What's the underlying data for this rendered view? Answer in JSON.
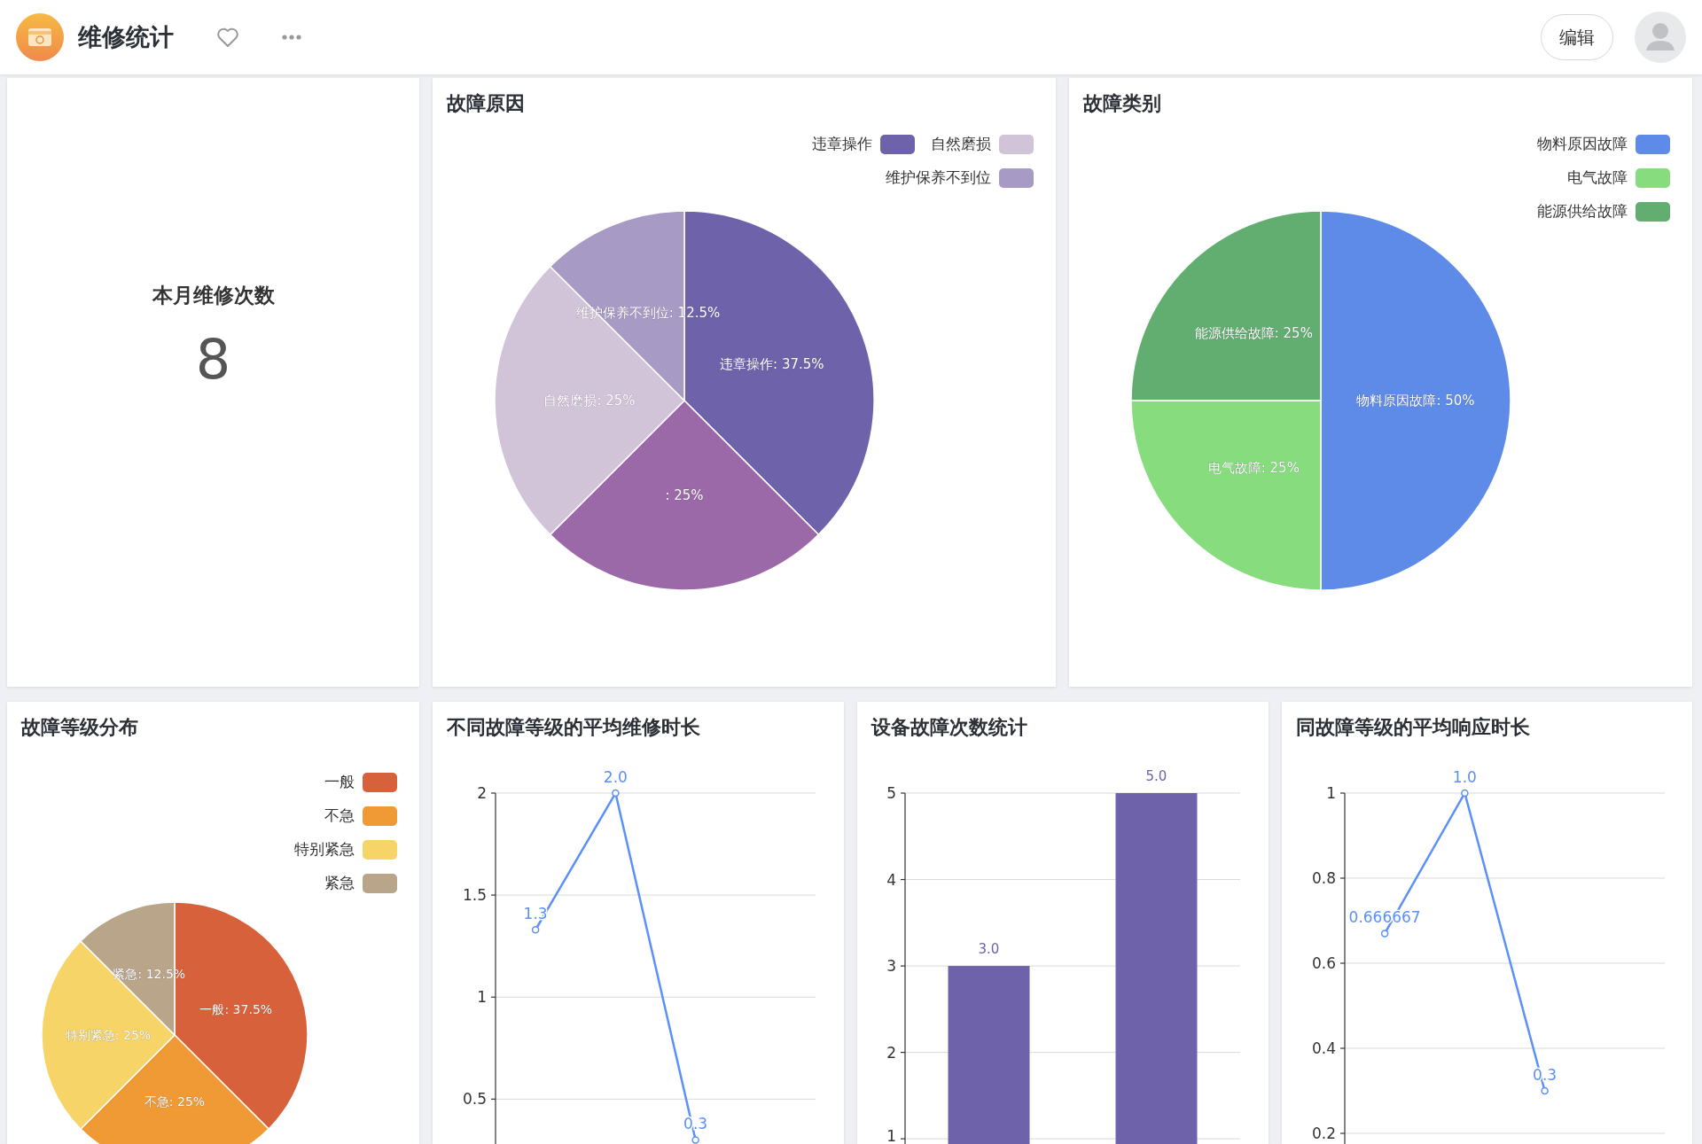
{
  "header": {
    "title": "维修统计",
    "edit_button": "编辑"
  },
  "cards": [
    {
      "kind": "stat",
      "title": "本月维修次数",
      "value": "8"
    },
    {
      "kind": "pie",
      "title": "故障原因",
      "legend": [
        {
          "label": "违章操作",
          "color": "#6e62aa"
        },
        {
          "label": "自然磨损",
          "color": "#d1c4d9"
        },
        {
          "label": "维护保养不到位",
          "color": "#a79bc6"
        }
      ],
      "chart_data": {
        "type": "pie",
        "values": [
          37.5,
          25,
          25,
          12.5
        ],
        "colors": [
          "#6e62aa",
          "#9c69a8",
          "#d1c4d9",
          "#a79bc6"
        ],
        "annotations": [
          "违章操作: 37.5%",
          ": 25%",
          "自然磨损: 25%",
          "维护保养不到位: 12.5%"
        ]
      }
    },
    {
      "kind": "pie",
      "title": "故障类别",
      "legend": [
        {
          "label": "物料原因故障",
          "color": "#5f8be8"
        },
        {
          "label": "电气故障",
          "color": "#87dc7e"
        },
        {
          "label": "能源供给故障",
          "color": "#62ae70"
        }
      ],
      "chart_data": {
        "type": "pie",
        "values": [
          50,
          25,
          25
        ],
        "colors": [
          "#5f8be8",
          "#87dc7e",
          "#62ae70"
        ],
        "annotations": [
          "物料原因故障: 50%",
          "电气故障: 25%",
          "能源供给故障: 25%"
        ]
      }
    },
    {
      "kind": "pie",
      "title": "故障等级分布",
      "legend": [
        {
          "label": "一般",
          "color": "#d6613b"
        },
        {
          "label": "不急",
          "color": "#f09a36"
        },
        {
          "label": "特别紧急",
          "color": "#f7d468"
        },
        {
          "label": "紧急",
          "color": "#b9a58a"
        }
      ],
      "chart_data": {
        "type": "pie",
        "values": [
          37.5,
          25,
          25,
          12.5
        ],
        "colors": [
          "#d6613b",
          "#f09a36",
          "#f7d468",
          "#b9a58a"
        ],
        "annotations": [
          "一般: 37.5%",
          "不急: 25%",
          "特别紧急: 25%",
          "紧急: 12.5%"
        ]
      }
    },
    {
      "kind": "line",
      "title": "不同故障等级的平均维修时长",
      "chart_data": {
        "type": "line",
        "ylim": [
          0.28,
          2
        ],
        "yticks": [
          0.5,
          1,
          1.5,
          2
        ],
        "grid": true,
        "series": [
          {
            "color": "#5b8ff9",
            "values": [
              1.33,
              2.0,
              0.3,
              null
            ],
            "marker": "o"
          }
        ],
        "value_labels": [
          "1.3",
          "2.0",
          "0.3"
        ]
      }
    },
    {
      "kind": "bar",
      "title": "设备故障次数统计",
      "chart_data": {
        "type": "bar",
        "ylim": [
          0.94,
          5
        ],
        "yticks": [
          1,
          2,
          3,
          4,
          5
        ],
        "grid": true,
        "series": [
          {
            "color": "#6e62aa",
            "values": [
              3,
              5
            ]
          }
        ],
        "value_labels": [
          "3.0",
          "5.0"
        ]
      }
    },
    {
      "kind": "line",
      "title": "同故障等级的平均响应时长",
      "chart_data": {
        "type": "line",
        "ylim": [
          0.175,
          1
        ],
        "yticks": [
          0.2,
          0.4,
          0.6,
          0.8,
          1
        ],
        "grid": true,
        "series": [
          {
            "color": "#5b8ff9",
            "values": [
              0.67,
              1.0,
              0.3,
              null
            ],
            "marker": "o"
          }
        ],
        "value_labels": [
          "0.666667",
          "1.0",
          "0.3"
        ]
      }
    }
  ]
}
